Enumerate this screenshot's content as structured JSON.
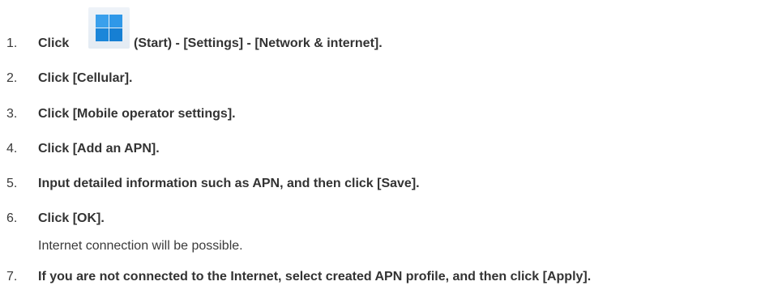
{
  "steps": [
    {
      "number": "1.",
      "click": "Click",
      "text": "(Start) - [Settings] - [Network & internet]."
    },
    {
      "number": "2.",
      "text": "Click [Cellular]."
    },
    {
      "number": "3.",
      "text": "Click [Mobile operator settings]."
    },
    {
      "number": "4.",
      "text": "Click [Add an APN]."
    },
    {
      "number": "5.",
      "text": "Input detailed information such as APN, and then click [Save]."
    },
    {
      "number": "6.",
      "text": "Click [OK].",
      "note": "Internet connection will be possible."
    },
    {
      "number": "7.",
      "text": "If you are not connected to the Internet, select created APN profile, and then click [Apply]."
    }
  ],
  "icons": {
    "start": "windows-start-icon"
  }
}
